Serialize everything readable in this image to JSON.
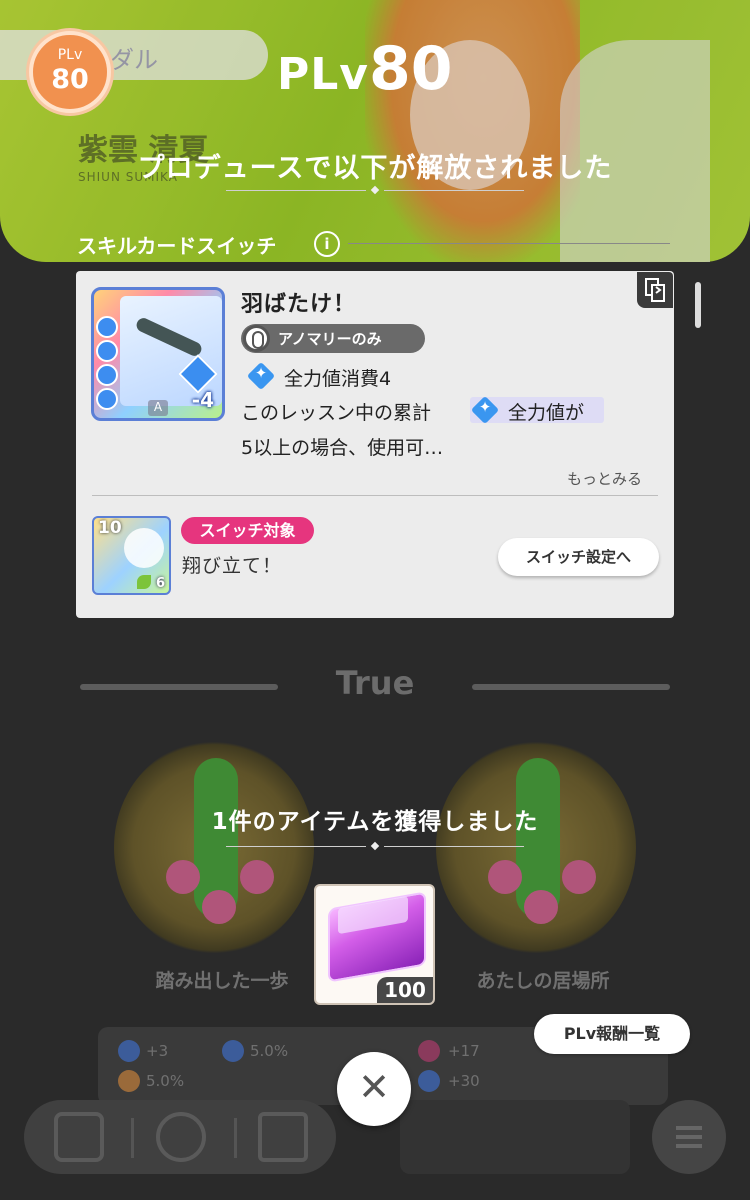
{
  "header": {
    "plv_badge_label": "PLv",
    "plv_badge_value": "80",
    "title_label": "PLv",
    "title_value": "80",
    "unlocked_message": "プロデュースで以下が解放されました"
  },
  "background": {
    "name_pill_text": "ダル",
    "idol_name": "紫雲 清夏",
    "idol_name_romaji": "SHIUN SUMIKA",
    "section_label": "True",
    "badges": [
      {
        "label": "踏み出した一歩"
      },
      {
        "label": "あたしの居場所"
      }
    ],
    "stats": [
      "+3",
      "5.0%",
      "+17",
      "5.0%",
      "+30"
    ]
  },
  "skill_card_switch": {
    "section_title": "スキルカードスイッチ",
    "info_icon": "info-icon",
    "card": {
      "name": "羽ばたけ！",
      "cost": "-4",
      "rank": "A",
      "restriction": "アノマリーのみ",
      "effect_prefix": "全力値消費4",
      "description_line1_a": "このレッスン中の累計",
      "description_line1_b": "全力値が",
      "description_line2": "5以上の場合、使用可…",
      "more_label": "もっとみる"
    },
    "switch_card": {
      "level": "10",
      "cost": "6",
      "tag": "スイッチ対象",
      "name": "翔び立て！",
      "settings_button": "スイッチ設定へ"
    }
  },
  "acquired": {
    "message": "1件のアイテムを獲得しました",
    "item_quantity": "100"
  },
  "footer": {
    "plv_rewards_button": "PLv報酬一覧",
    "close_icon": "✕"
  },
  "colors": {
    "badge_orange": "#f1914f",
    "switch_tag_pink": "#e6357e",
    "gem_blue": "#3a96f0",
    "background_green": "#9fcf2a"
  }
}
